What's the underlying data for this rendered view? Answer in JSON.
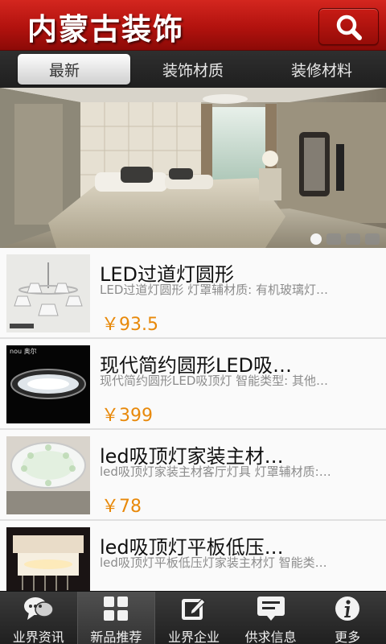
{
  "header": {
    "title": "内蒙古装饰",
    "search_icon": "search-icon",
    "bg_color": "#b2120e"
  },
  "tabs": [
    {
      "label": "最新",
      "active": true
    },
    {
      "label": "装饰材质",
      "active": false
    },
    {
      "label": "装修材料",
      "active": false
    }
  ],
  "banner": {
    "image": "bedroom-interior-photo",
    "slide_count": 4,
    "active_slide": 1
  },
  "products": [
    {
      "title": "LED过道灯圆形",
      "desc": "LED过道灯圆形 灯罩辅材质: 有机玻璃灯…",
      "price": "￥93.5",
      "image": "chandelier-photo"
    },
    {
      "title": "现代简约圆形LED吸…",
      "desc": "现代简约圆形LED吸顶灯 智能类型: 其他…",
      "price": "￥399",
      "image": "round-ceiling-light-photo",
      "brand_text": "nou 奥尔"
    },
    {
      "title": "led吸顶灯家装主材…",
      "desc": "led吸顶灯家装主材客厅灯具 灯罩辅材质:…",
      "price": "￥78",
      "image": "floral-ceiling-light-photo"
    },
    {
      "title": "led吸顶灯平板低压…",
      "desc": "led吸顶灯平板低压灯家装主材灯 智能类…",
      "price": "",
      "image": "crystal-ceiling-light-photo"
    }
  ],
  "bottom_nav": [
    {
      "label": "业界资讯",
      "icon": "chat-bubbles-icon",
      "active": false
    },
    {
      "label": "新品推荐",
      "icon": "grid-icon",
      "active": true
    },
    {
      "label": "业界企业",
      "icon": "edit-icon",
      "active": false
    },
    {
      "label": "供求信息",
      "icon": "message-icon",
      "active": false
    },
    {
      "label": "更多",
      "icon": "info-icon",
      "active": false
    }
  ],
  "colors": {
    "accent_red": "#c81b15",
    "price_orange": "#e8890a",
    "nav_dark": "#2a2a2a"
  }
}
